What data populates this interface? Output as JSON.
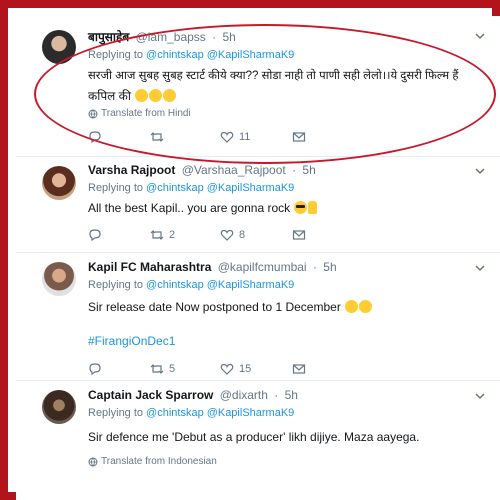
{
  "tweets": [
    {
      "name": "बापुसाहेब",
      "handle": "@iam_bapss",
      "time": "5h",
      "replying_label": "Replying to",
      "handles": [
        "@chintskap",
        "@KapilSharmaK9"
      ],
      "text_line1": "सरजी आज सुबह सुबह स्टार्ट कीये क्या?? सोडा नाही तो पाणी सही लेलो।।ये दुसरी फिल्म हैं",
      "text_line2": "कपिल की",
      "translate": "Translate from Hindi",
      "counts": {
        "reply": "",
        "retweet": "",
        "like": "11"
      },
      "emoji_count": 3
    },
    {
      "name": "Varsha Rajpoot",
      "handle": "@Varshaa_Rajpoot",
      "time": "5h",
      "replying_label": "Replying to",
      "handles": [
        "@chintskap",
        "@KapilSharmaK9"
      ],
      "text": "All the best Kapil.. you are gonna rock",
      "counts": {
        "reply": "",
        "retweet": "2",
        "like": "8"
      }
    },
    {
      "name": "Kapil FC Maharashtra",
      "handle": "@kapilfcmumbai",
      "time": "5h",
      "replying_label": "Replying to",
      "handles": [
        "@chintskap",
        "@KapilSharmaK9"
      ],
      "text": "Sir release date Now postponed to 1 December",
      "hashtag": "#FirangiOnDec1",
      "counts": {
        "reply": "",
        "retweet": "5",
        "like": "15"
      }
    },
    {
      "name": "Captain Jack Sparrow",
      "handle": "@dixarth",
      "time": "5h",
      "replying_label": "Replying to",
      "handles": [
        "@chintskap",
        "@KapilSharmaK9"
      ],
      "text": "Sir defence me 'Debut as a producer' likh dijiye. Maza aayega.",
      "translate": "Translate from Indonesian"
    }
  ],
  "separator": "·",
  "icons": [
    "globe-icon",
    "reply-icon",
    "retweet-icon",
    "heart-icon",
    "envelope-icon",
    "chevron-down-icon"
  ],
  "colors": {
    "link": "#1b95e0",
    "frame": "#b3141b",
    "highlight": "#c8192a"
  }
}
